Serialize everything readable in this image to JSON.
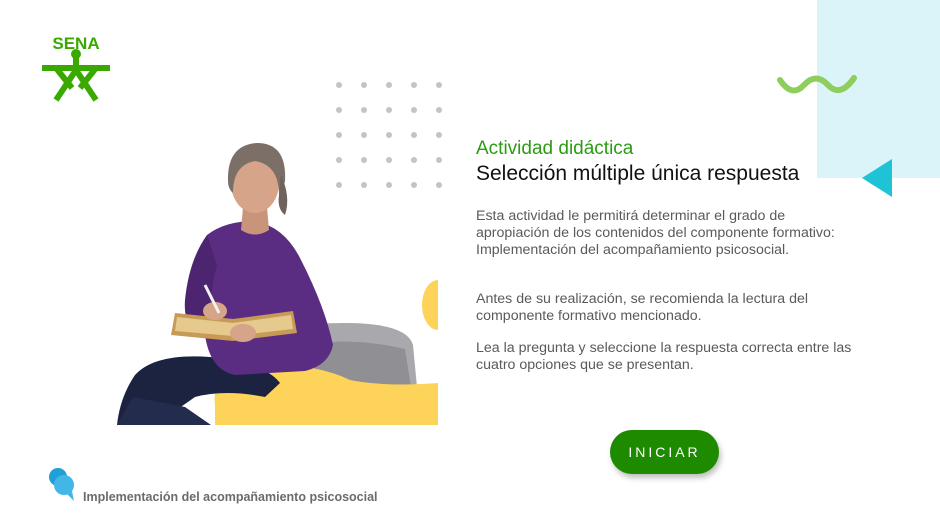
{
  "brand": {
    "logo_text": "SENA",
    "color": "#39a900"
  },
  "heading": {
    "subtitle": "Actividad didáctica",
    "title": "Selección múltiple única respuesta"
  },
  "paragraphs": [
    "Esta actividad le permitirá determinar el grado de apropiación de los contenidos del componente formativo: Implementación del acompañamiento psicosocial.",
    "Antes de su realización, se recomienda la lectura del componente formativo mencionado.",
    "Lea la pregunta y seleccione la respuesta correcta entre las cuatro opciones que se presentan."
  ],
  "start_button": {
    "label": "INICIAR",
    "color": "#1d8a00"
  },
  "footer": {
    "text": "Implementación del acompañamiento psicosocial",
    "icon": "chat-bubbles-icon"
  },
  "colors": {
    "accent_green": "#2c9b14",
    "accent_cyan": "#1fc3d6",
    "panel_cyan": "#daf4f9",
    "accent_yellow": "#fdd35a",
    "wave_green": "#8dce5c"
  }
}
